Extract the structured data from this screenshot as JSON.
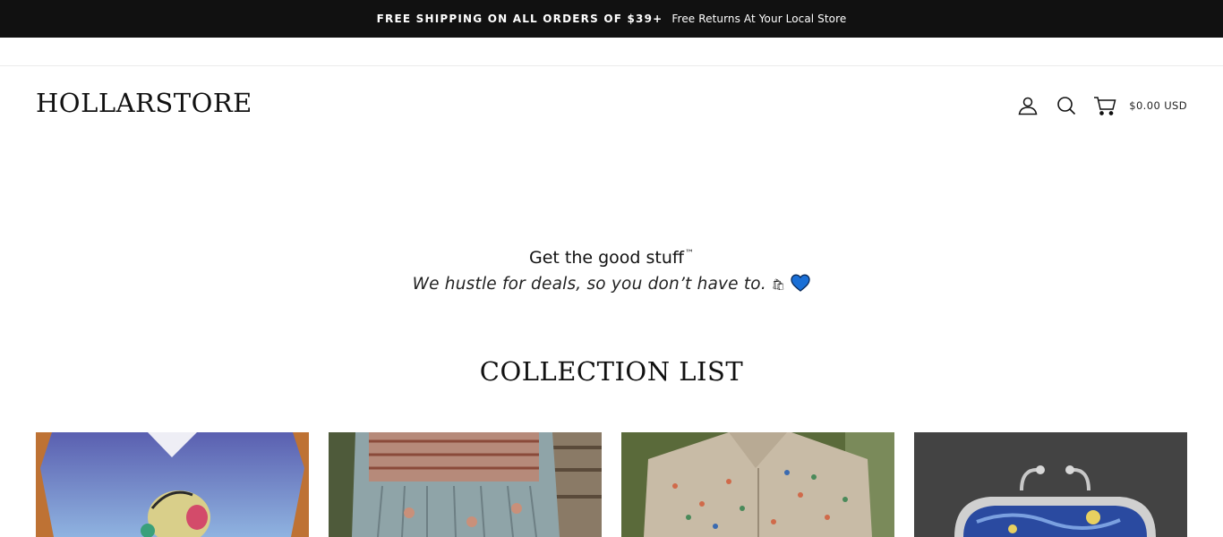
{
  "announcement": {
    "bold_text": "FREE SHIPPING ON ALL ORDERS OF $39+",
    "normal_text": "Free Returns At Your Local Store"
  },
  "header": {
    "logo": "HOLLARSTORE",
    "icons": [
      "account-icon",
      "search-icon",
      "cart-icon"
    ],
    "cart_total": "$0.00 USD"
  },
  "tagline": {
    "title": "Get the good stuff",
    "trademark": "™",
    "subtitle": "We hustle for deals, so you don’t have to.",
    "emoji": "🛍"
  },
  "collections": {
    "title": "COLLECTION LIST",
    "items": [
      {
        "image": "graphic-tshirt-image"
      },
      {
        "image": "boho-dress-image"
      },
      {
        "image": "floral-shirt-image"
      },
      {
        "image": "coin-purse-image"
      }
    ]
  },
  "colors": {
    "announcement_bg": "#111111",
    "heart": "#1a6fd6"
  }
}
